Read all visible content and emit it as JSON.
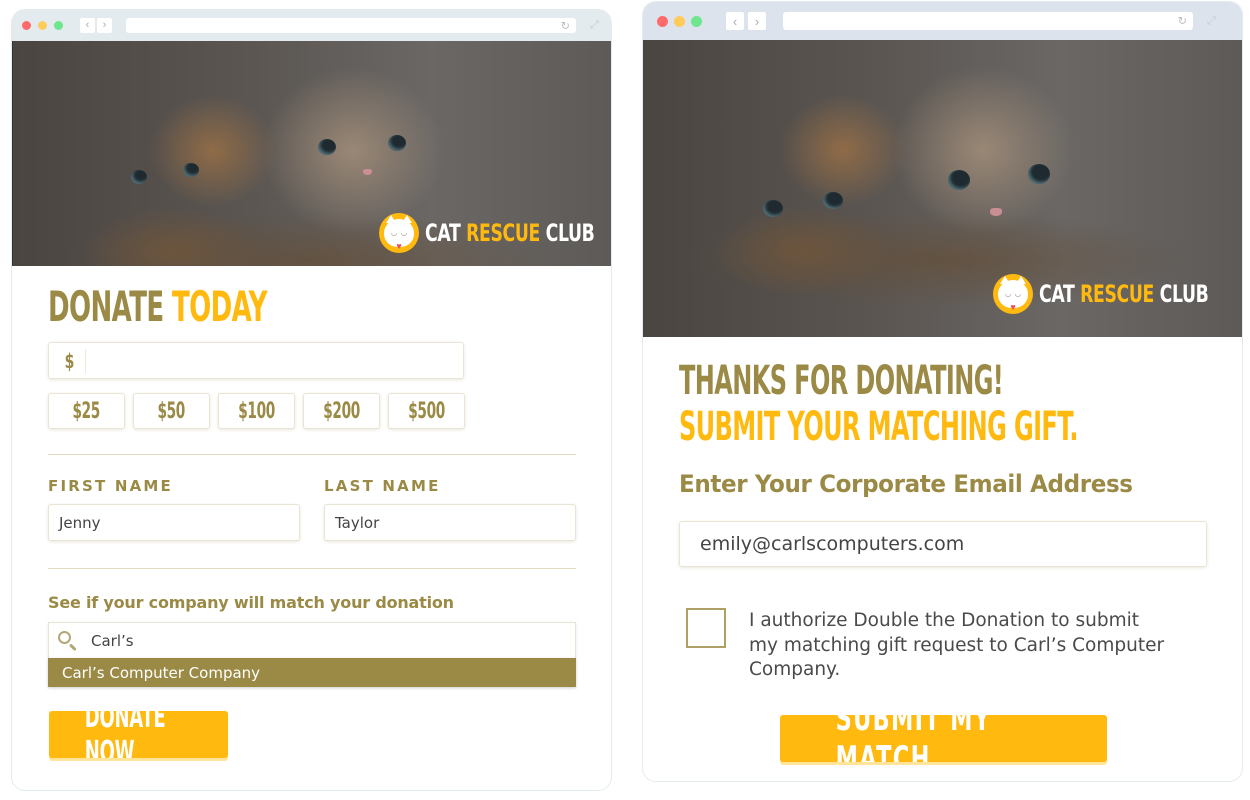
{
  "colors": {
    "olive": "#9b8a45",
    "gold": "#ffb90f",
    "dot_red": "#ff6b6b",
    "dot_yellow": "#ffcc5c",
    "dot_green": "#6ee68d"
  },
  "left_window": {
    "chrome": {
      "back_icon": "‹",
      "forward_icon": "›",
      "reload_icon": "↻",
      "expand_icon": "⤢"
    },
    "brand": {
      "word1": "CAT",
      "word2": "RESCUE",
      "word3": "CLUB"
    },
    "title": {
      "part1": "DONATE",
      "part2": "TODAY"
    },
    "amount": {
      "currency_symbol": "$",
      "value": ""
    },
    "presets": [
      "$25",
      "$50",
      "$100",
      "$200",
      "$500"
    ],
    "first_name": {
      "label": "FIRST NAME",
      "value": "Jenny"
    },
    "last_name": {
      "label": "LAST NAME",
      "value": "Taylor"
    },
    "match": {
      "label": "See if your company will match your donation",
      "search_value": "Carl’s",
      "suggestion": "Carl’s Computer Company"
    },
    "donate_button": "DONATE NOW"
  },
  "right_window": {
    "chrome": {
      "back_icon": "‹",
      "forward_icon": "›",
      "reload_icon": "↻",
      "expand_icon": "⤢"
    },
    "brand": {
      "word1": "CAT",
      "word2": "RESCUE",
      "word3": "CLUB"
    },
    "title": {
      "line1": "THANKS FOR DONATING!",
      "line2": "SUBMIT YOUR MATCHING GIFT."
    },
    "email_label": "Enter Your Corporate Email Address",
    "email_value": "emily@carlscomputers.com",
    "consent_checked": false,
    "consent_text": "I authorize Double the Donation to submit my matching gift request to Carl’s Computer Company.",
    "submit_button": "SUBMIT MY MATCH"
  }
}
